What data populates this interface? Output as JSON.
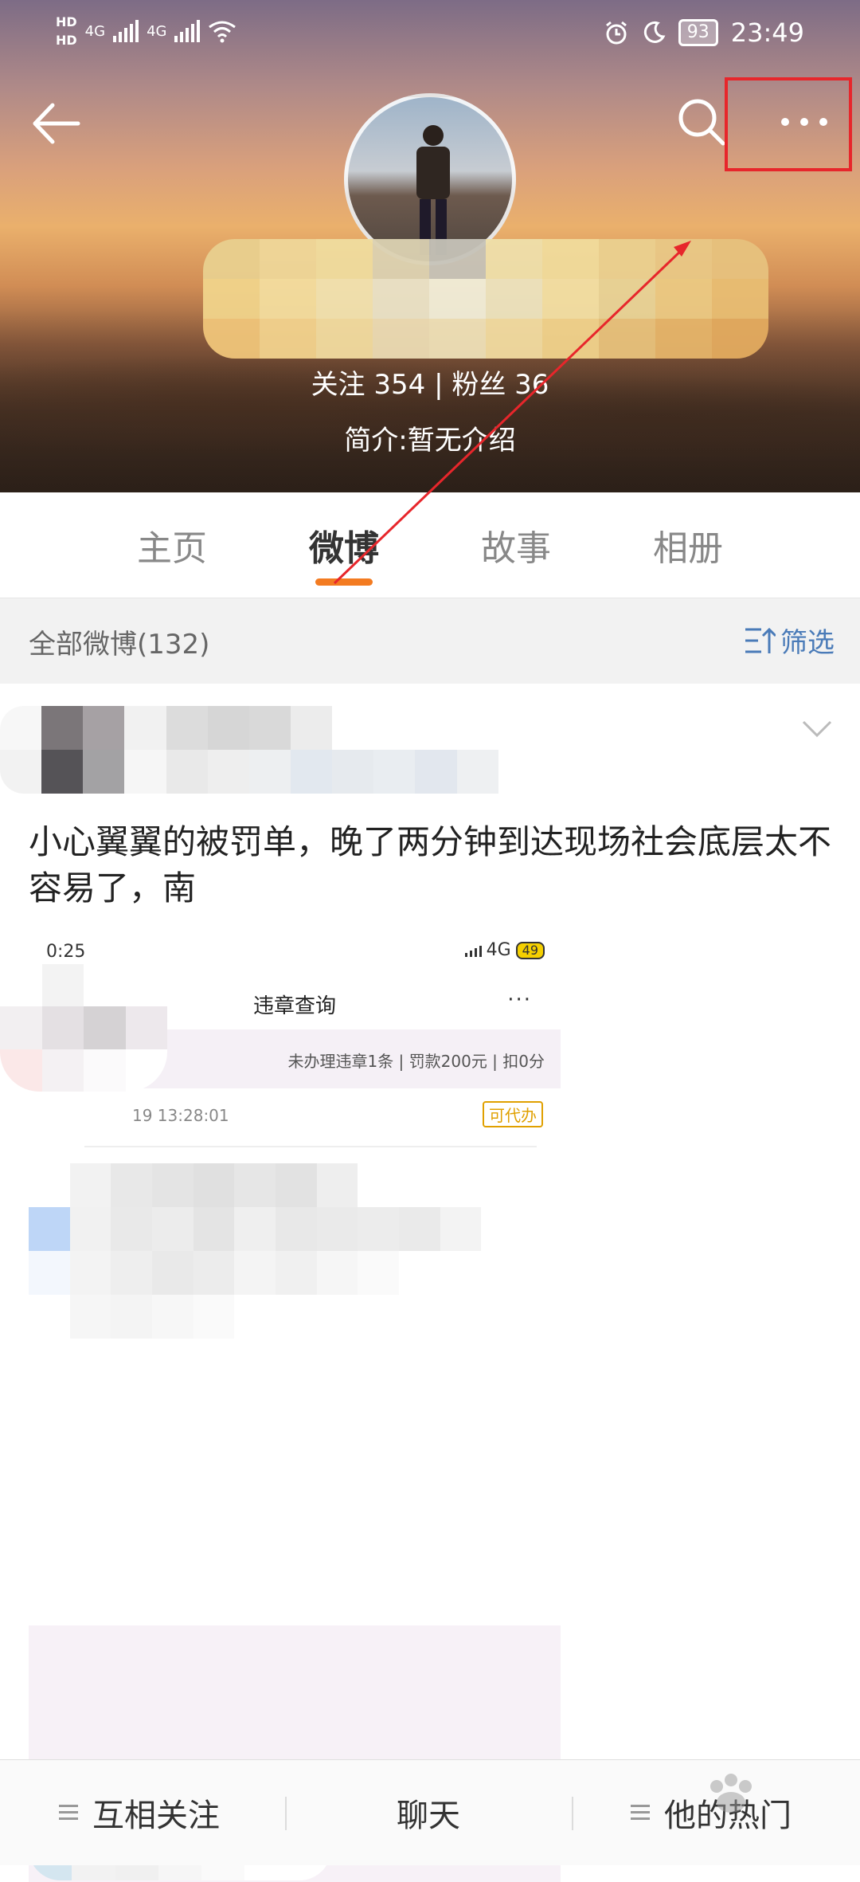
{
  "statusbar": {
    "hd1": "HD",
    "hd2": "HD",
    "net1": "4G",
    "net2": "4G",
    "battery": "93",
    "time": "23:49"
  },
  "header": {
    "stats": "关注  354    |    粉丝  36",
    "bio": "简介:暂无介绍"
  },
  "tabs": [
    {
      "label": "主页"
    },
    {
      "label": "微博"
    },
    {
      "label": "故事"
    },
    {
      "label": "相册"
    }
  ],
  "filter": {
    "count": "全部微博(132)",
    "button": "筛选"
  },
  "post": {
    "text": "小心翼翼的被罚单，晚了两分钟到达现场社会底层太不容易了，南"
  },
  "inner_screenshot": {
    "time": "0:25",
    "network": "4G",
    "battery": "49",
    "title": "违章查询",
    "more": "···",
    "summary": "未办理违章1条 | 罚款200元 | 扣0分",
    "date": "19 13:28:01",
    "tag": "可代办"
  },
  "bottombar": {
    "follow": "互相关注",
    "chat": "聊天",
    "hot": "他的热门"
  },
  "colors": {
    "accent_orange": "#f37b21",
    "link_blue": "#4a7bb8",
    "highlight_red": "#e7262b"
  }
}
